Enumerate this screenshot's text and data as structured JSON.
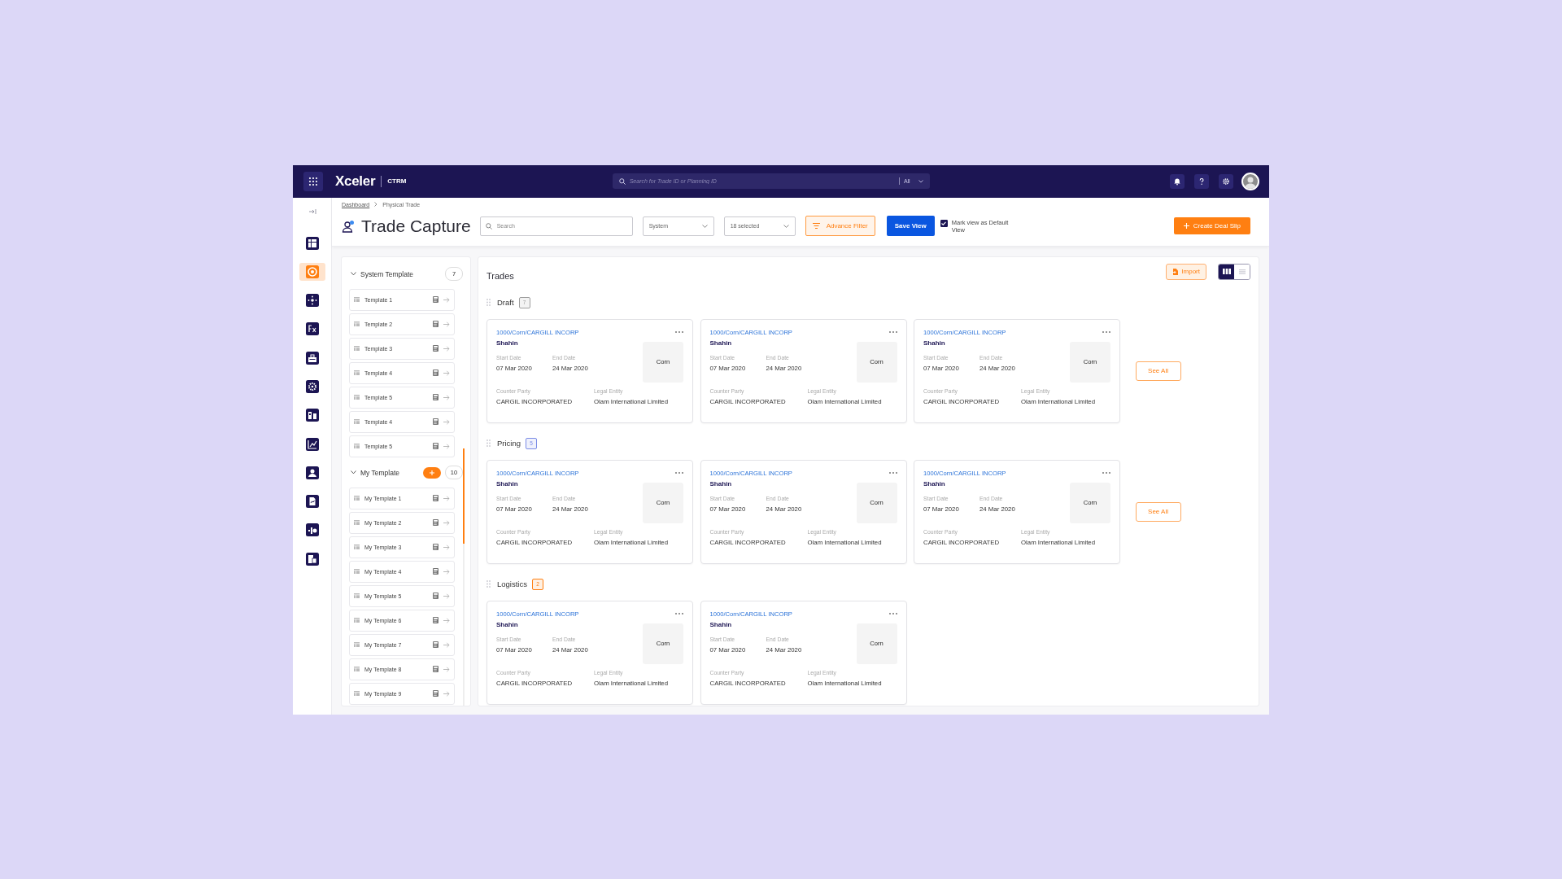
{
  "topbar": {
    "logo": "Xceler",
    "product": "CTRM",
    "search": {
      "placeholder": "Search for Trade ID or Planning ID",
      "scope": "All"
    }
  },
  "nav": {
    "items": [
      {
        "selected": false
      },
      {
        "selected": true
      },
      {
        "selected": false
      },
      {
        "selected": false
      },
      {
        "selected": false
      },
      {
        "selected": false
      },
      {
        "selected": false
      },
      {
        "selected": false
      },
      {
        "selected": false
      },
      {
        "selected": false
      },
      {
        "selected": false
      },
      {
        "selected": false
      }
    ]
  },
  "breadcrumb": [
    "Dashboard",
    "Physical Trade"
  ],
  "page": {
    "title": "Trade Capture",
    "search": {
      "placeholder": "Search"
    },
    "view_select": "System",
    "columns_select": "18 selected",
    "filter_button": "Advance Filter",
    "save_button": "Save View",
    "default_view": {
      "label": "Mark view as Default View",
      "checked": true
    },
    "create_button": "Create Deal Slip"
  },
  "templates": {
    "groups": [
      {
        "title": "System Template",
        "count": "7",
        "expanded": true,
        "add_button": false,
        "items": [
          "Template 1",
          "Template 2",
          "Template 3",
          "Template 4",
          "Template 5",
          "Template 4",
          "Template 5"
        ]
      },
      {
        "title": "My Template",
        "count": "10",
        "expanded": true,
        "add_button": true,
        "items": [
          "My Template 1",
          "My Template 2",
          "My Template 3",
          "My Template 4",
          "My Template 5",
          "My Template 6",
          "My Template 7",
          "My Template 8",
          "My Template 9"
        ]
      }
    ]
  },
  "trades": {
    "title": "Trades",
    "import_button": "Import",
    "view_toggle": [
      {
        "selected": true
      },
      {
        "selected": false
      }
    ],
    "sections": [
      {
        "name": "Draft",
        "count": "7",
        "color": "#9e9e9e",
        "see_all": "See All",
        "cards": [
          {
            "trade_id": "1000/Corn/CARGILL INCORP",
            "trader": "Shahin",
            "start_label": "Start Date",
            "start": "07 Mar 2020",
            "end_label": "End Date",
            "end": "24 Mar 2020",
            "commodity": "Corn",
            "counterparty_label": "Counter Party",
            "counterparty": "CARGIL INCORPORATED",
            "entity_label": "Legal Entity",
            "entity": "Olam International Limited"
          },
          {
            "trade_id": "1000/Corn/CARGILL INCORP",
            "trader": "Shahin",
            "start_label": "Start Date",
            "start": "07 Mar 2020",
            "end_label": "End Date",
            "end": "24 Mar 2020",
            "commodity": "Corn",
            "counterparty_label": "Counter Party",
            "counterparty": "CARGIL INCORPORATED",
            "entity_label": "Legal Entity",
            "entity": "Olam International Limited"
          },
          {
            "trade_id": "1000/Corn/CARGILL INCORP",
            "trader": "Shahin",
            "start_label": "Start Date",
            "start": "07 Mar 2020",
            "end_label": "End Date",
            "end": "24 Mar 2020",
            "commodity": "Corn",
            "counterparty_label": "Counter Party",
            "counterparty": "CARGIL INCORPORATED",
            "entity_label": "Legal Entity",
            "entity": "Olam International Limited"
          }
        ]
      },
      {
        "name": "Pricing",
        "count": "5",
        "color": "#7b8ce6",
        "see_all": "See All",
        "cards": [
          {
            "trade_id": "1000/Corn/CARGILL INCORP",
            "trader": "Shahin",
            "start_label": "Start Date",
            "start": "07 Mar 2020",
            "end_label": "End Date",
            "end": "24 Mar 2020",
            "commodity": "Corn",
            "counterparty_label": "Counter Party",
            "counterparty": "CARGIL INCORPORATED",
            "entity_label": "Legal Entity",
            "entity": "Olam International Limited"
          },
          {
            "trade_id": "1000/Corn/CARGILL INCORP",
            "trader": "Shahin",
            "start_label": "Start Date",
            "start": "07 Mar 2020",
            "end_label": "End Date",
            "end": "24 Mar 2020",
            "commodity": "Corn",
            "counterparty_label": "Counter Party",
            "counterparty": "CARGIL INCORPORATED",
            "entity_label": "Legal Entity",
            "entity": "Olam International Limited"
          },
          {
            "trade_id": "1000/Corn/CARGILL INCORP",
            "trader": "Shahin",
            "start_label": "Start Date",
            "start": "07 Mar 2020",
            "end_label": "End Date",
            "end": "24 Mar 2020",
            "commodity": "Corn",
            "counterparty_label": "Counter Party",
            "counterparty": "CARGIL INCORPORATED",
            "entity_label": "Legal Entity",
            "entity": "Olam International Limited"
          }
        ]
      },
      {
        "name": "Logistics",
        "count": "2",
        "color": "#ff7f11",
        "cards": [
          {
            "trade_id": "1000/Corn/CARGILL INCORP",
            "trader": "Shahin",
            "start_label": "Start Date",
            "start": "07 Mar 2020",
            "end_label": "End Date",
            "end": "24 Mar 2020",
            "commodity": "Corn",
            "counterparty_label": "Counter Party",
            "counterparty": "CARGIL INCORPORATED",
            "entity_label": "Legal Entity",
            "entity": "Olam International Limited"
          },
          {
            "trade_id": "1000/Corn/CARGILL INCORP",
            "trader": "Shahin",
            "start_label": "Start Date",
            "start": "07 Mar 2020",
            "end_label": "End Date",
            "end": "24 Mar 2020",
            "commodity": "Corn",
            "counterparty_label": "Counter Party",
            "counterparty": "CARGIL INCORPORATED",
            "entity_label": "Legal Entity",
            "entity": "Olam International Limited"
          }
        ]
      }
    ]
  }
}
